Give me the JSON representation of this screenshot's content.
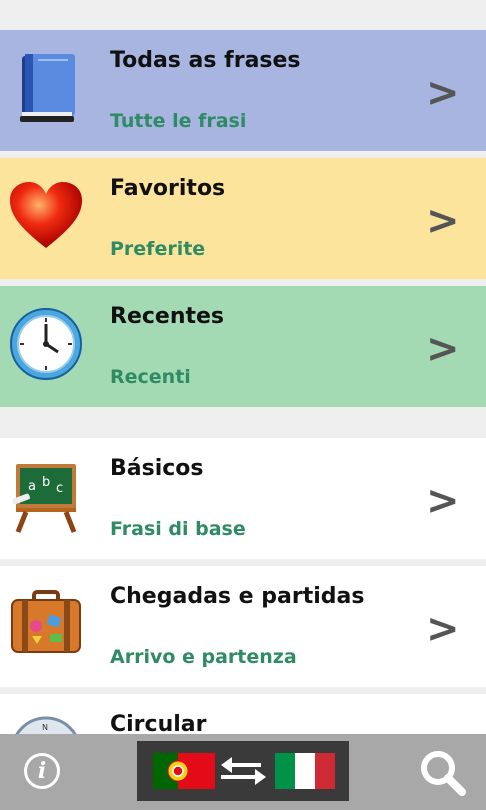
{
  "menu": [
    {
      "title": "Todas as frases",
      "subtitle": "Tutte le frasi",
      "icon": "book-icon",
      "bg": "#a7b5e0"
    },
    {
      "title": "Favoritos",
      "subtitle": "Preferite",
      "icon": "heart-icon",
      "bg": "#fde49c"
    },
    {
      "title": "Recentes",
      "subtitle": "Recenti",
      "icon": "clock-icon",
      "bg": "#a3dab3"
    },
    {
      "title": "Básicos",
      "subtitle": "Frasi di base",
      "icon": "chalkboard-icon",
      "bg": "#ffffff"
    },
    {
      "title": "Chegadas e partidas",
      "subtitle": "Arrivo e partenza",
      "icon": "suitcase-icon",
      "bg": "#ffffff"
    },
    {
      "title": "Circular",
      "subtitle": "",
      "icon": "compass-icon",
      "bg": "#ffffff"
    }
  ],
  "chevron": ">",
  "bottom_bar": {
    "info_label": "i",
    "info_icon": "info-icon",
    "swap_icon": "swap-arrows-icon",
    "search_icon": "search-icon",
    "from_flag": "portugal-flag-icon",
    "to_flag": "italy-flag-icon"
  }
}
